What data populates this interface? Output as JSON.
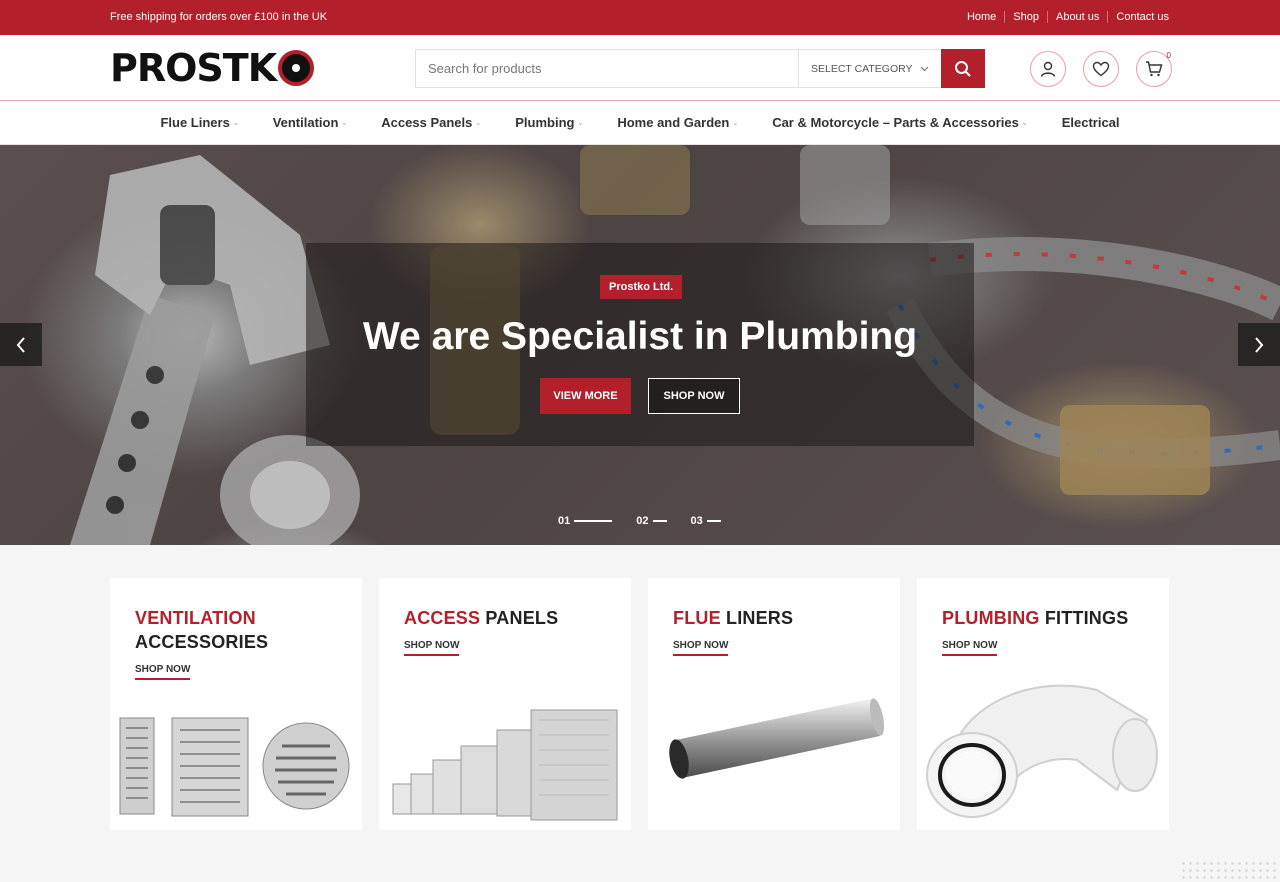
{
  "topbar": {
    "shipping_text": "Free shipping for orders over £100 in the UK",
    "links": [
      "Home",
      "Shop",
      "About us",
      "Contact us"
    ]
  },
  "header": {
    "logo_text": "PROSTK",
    "search_placeholder": "Search for products",
    "category_select": "SELECT CATEGORY",
    "cart_count": "0"
  },
  "nav": {
    "items": [
      {
        "label": "Flue Liners"
      },
      {
        "label": "Ventilation"
      },
      {
        "label": "Access Panels"
      },
      {
        "label": "Plumbing"
      },
      {
        "label": "Home and Garden"
      },
      {
        "label": "Car & Motorcycle – Parts & Accessories"
      },
      {
        "label": "Electrical"
      }
    ]
  },
  "hero": {
    "tag": "Prostko Ltd.",
    "title": "We are Specialist in Plumbing",
    "view_more": "VIEW MORE",
    "shop_now": "SHOP NOW",
    "slides": [
      "01",
      "02",
      "03"
    ]
  },
  "cards": [
    {
      "red": "VENTILATION",
      "dark": "ACCESSORIES",
      "shop": "SHOP NOW"
    },
    {
      "red": "ACCESS",
      "dark": "PANELS",
      "shop": "SHOP NOW"
    },
    {
      "red": "FLUE",
      "dark": "LINERS",
      "shop": "SHOP NOW"
    },
    {
      "red": "PLUMBING",
      "dark": "FITTINGS",
      "shop": "SHOP NOW"
    }
  ],
  "colors": {
    "brand_red": "#b31f2b"
  }
}
